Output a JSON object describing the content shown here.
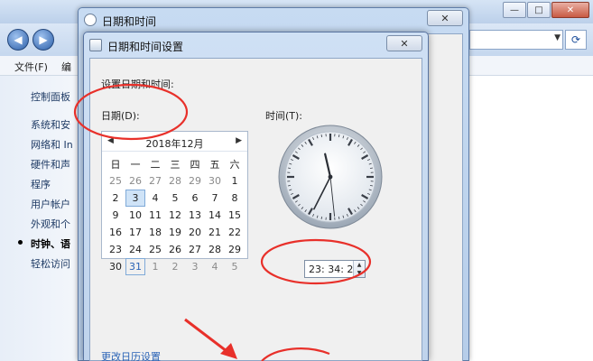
{
  "control_panel": {
    "menu": [
      "文件(F)",
      "编"
    ],
    "sidebar": [
      "控制面板",
      "系统和安",
      "网络和 In",
      "硬件和声",
      "程序",
      "用户帐户",
      "外观和个",
      "时钟、语",
      "轻松访问"
    ],
    "current_index": 7
  },
  "datetime_dialog": {
    "title": "日期和时间"
  },
  "settings_dialog": {
    "title": "日期和时间设置",
    "heading": "设置日期和时间:",
    "date_label": "日期(D):",
    "time_label": "时间(T):",
    "calendar": {
      "month_title": "2018年12月",
      "weekdays": [
        "日",
        "一",
        "二",
        "三",
        "四",
        "五",
        "六"
      ],
      "weeks": [
        [
          "25",
          "26",
          "27",
          "28",
          "29",
          "30",
          "1"
        ],
        [
          "2",
          "3",
          "4",
          "5",
          "6",
          "7",
          "8"
        ],
        [
          "9",
          "10",
          "11",
          "12",
          "13",
          "14",
          "15"
        ],
        [
          "16",
          "17",
          "18",
          "19",
          "20",
          "21",
          "22"
        ],
        [
          "23",
          "24",
          "25",
          "26",
          "27",
          "28",
          "29"
        ],
        [
          "30",
          "31",
          "1",
          "2",
          "3",
          "4",
          "5"
        ]
      ],
      "selected_day": "3",
      "today": "31"
    },
    "clock": {
      "hour": 23,
      "minute": 34,
      "second": 29
    },
    "time_value": "23: 34: 29",
    "change_calendar_link": "更改日历设置"
  },
  "colors": {
    "annotation": "#e8302a",
    "link": "#2a63b6"
  }
}
